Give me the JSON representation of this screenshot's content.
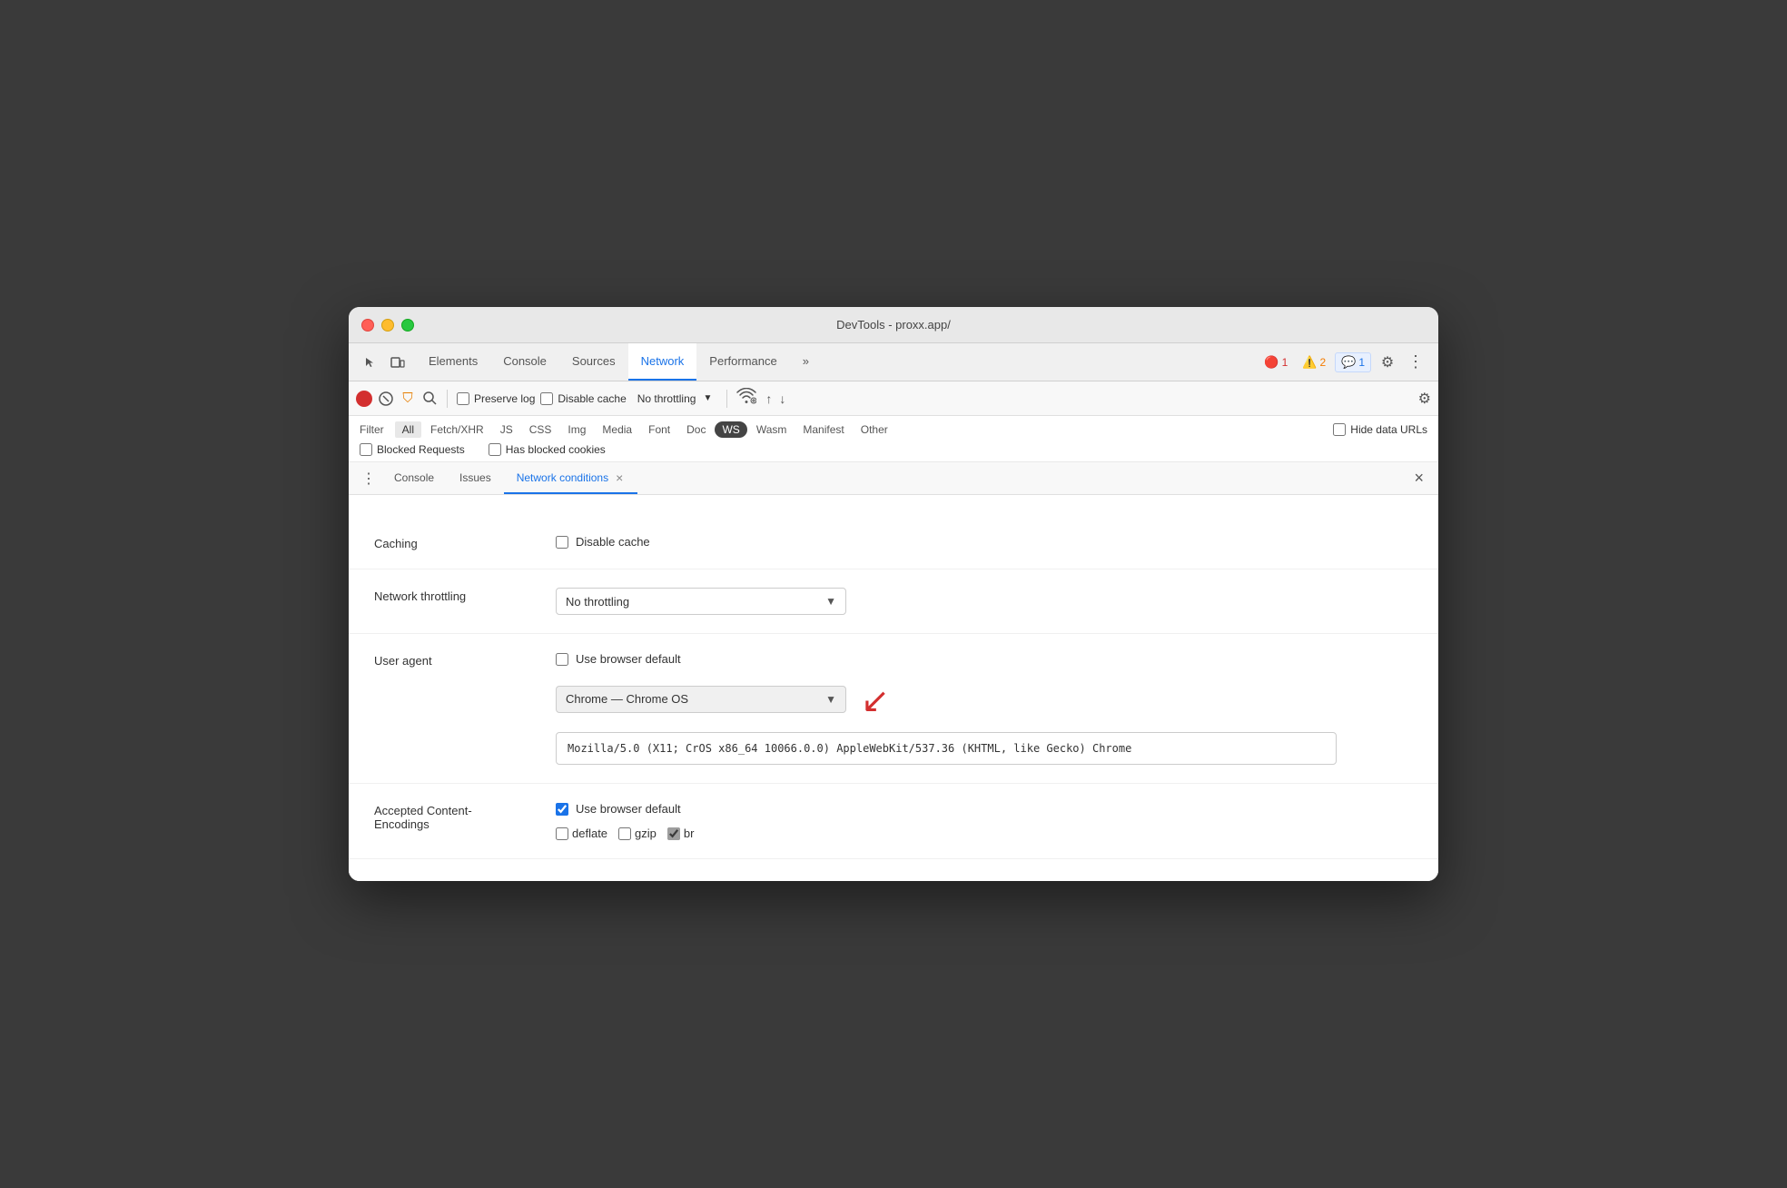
{
  "window": {
    "title": "DevTools - proxx.app/"
  },
  "tabs": {
    "items": [
      {
        "id": "elements",
        "label": "Elements",
        "active": false
      },
      {
        "id": "console",
        "label": "Console",
        "active": false
      },
      {
        "id": "sources",
        "label": "Sources",
        "active": false
      },
      {
        "id": "network",
        "label": "Network",
        "active": true
      },
      {
        "id": "performance",
        "label": "Performance",
        "active": false
      },
      {
        "id": "more",
        "label": "»",
        "active": false
      }
    ],
    "badges": {
      "error": "1",
      "warning": "2",
      "info": "1"
    }
  },
  "toolbar": {
    "preserve_log": "Preserve log",
    "disable_cache": "Disable cache",
    "no_throttling": "No throttling"
  },
  "filter": {
    "label": "Filter",
    "hide_data_urls": "Hide data URLs",
    "types": [
      "All",
      "Fetch/XHR",
      "JS",
      "CSS",
      "Img",
      "Media",
      "Font",
      "Doc",
      "WS",
      "Wasm",
      "Manifest",
      "Other"
    ],
    "has_blocked_cookies": "Has blocked cookies",
    "blocked_requests": "Blocked Requests"
  },
  "bottom_tabs": {
    "dots_label": "⋮",
    "items": [
      {
        "id": "console-bt",
        "label": "Console",
        "active": false
      },
      {
        "id": "issues-bt",
        "label": "Issues",
        "active": false
      },
      {
        "id": "network-conditions-bt",
        "label": "Network conditions",
        "active": true,
        "closable": true
      }
    ]
  },
  "network_conditions": {
    "caching_label": "Caching",
    "disable_cache_label": "Disable cache",
    "throttling_label": "Network throttling",
    "throttling_value": "No throttling",
    "user_agent_label": "User agent",
    "use_browser_default_label": "Use browser default",
    "user_agent_dropdown_value": "Chrome — Chrome OS",
    "ua_string": "Mozilla/5.0 (X11; CrOS x86_64 10066.0.0) AppleWebKit/537.36 (KHTML, like Gecko) Chrome",
    "accepted_encodings_label": "Accepted Content-\nEncodings",
    "use_browser_default_enc_label": "Use browser default",
    "deflate_label": "deflate",
    "gzip_label": "gzip",
    "br_label": "br"
  }
}
